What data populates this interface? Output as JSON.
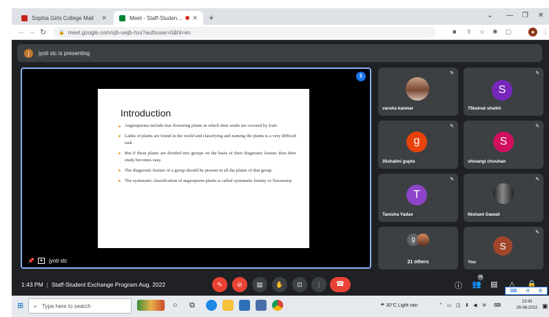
{
  "browser": {
    "tabs": [
      {
        "title": "Sophia Girls College Mail",
        "favicon_color": "#c5221f"
      },
      {
        "title": "Meet - Staff-Student Exchan",
        "favicon_color": "#00832d",
        "active": true
      }
    ],
    "new_tab": "+",
    "url": "meet.google.com/sjb-uwjb-hxx?authuser=0&hl=en"
  },
  "meet": {
    "presenting_banner": "jyoti stc is presenting",
    "presenter_initial": "j",
    "presenter_name": "jyoti stc",
    "slide": {
      "title": "Introduction",
      "bullets": [
        "Angiosperms include true flowering plants in which their seeds are covered by fruit.",
        "Lakhs of plants are found in the world and classifying and naming the plants is a very difficult task .",
        "But if these plants are divided into groups on the basis of their diagnostic feature then their study becomes easy.",
        "The diagnostic feature of a group should be present in all the plants of that group.",
        "The systematic classification of angiosperm plants is called systematic botany or Taxonomy."
      ]
    },
    "participants": [
      {
        "name": "varsha kanwar",
        "initial": "",
        "color": "#8b5a44"
      },
      {
        "name": "75kainat shaikh",
        "initial": "S",
        "color": "#7627bb"
      },
      {
        "name": "35shalini gupta",
        "initial": "g",
        "color": "#e8430a"
      },
      {
        "name": "shivangi chouhan",
        "initial": "S",
        "color": "#d0105e"
      },
      {
        "name": "Tanisha Yadav",
        "initial": "T",
        "color": "#8e44c8"
      },
      {
        "name": "Nishant Gawali",
        "initial": "",
        "color": "#3b3b3b"
      },
      {
        "name": "21 others",
        "initial": "g",
        "color": "#5f6368"
      },
      {
        "name": "You",
        "initial": "S",
        "color": "#a0452a"
      }
    ],
    "time": "1:43 PM",
    "meeting_title": "Staff-Student Exchange Program Aug. 2022",
    "participant_count": "28"
  },
  "taskbar": {
    "search_placeholder": "Type here to search",
    "weather": "30°C  Light rain",
    "clock_time": "13:43",
    "clock_date": "26-08-2022",
    "notification_count": "4"
  }
}
